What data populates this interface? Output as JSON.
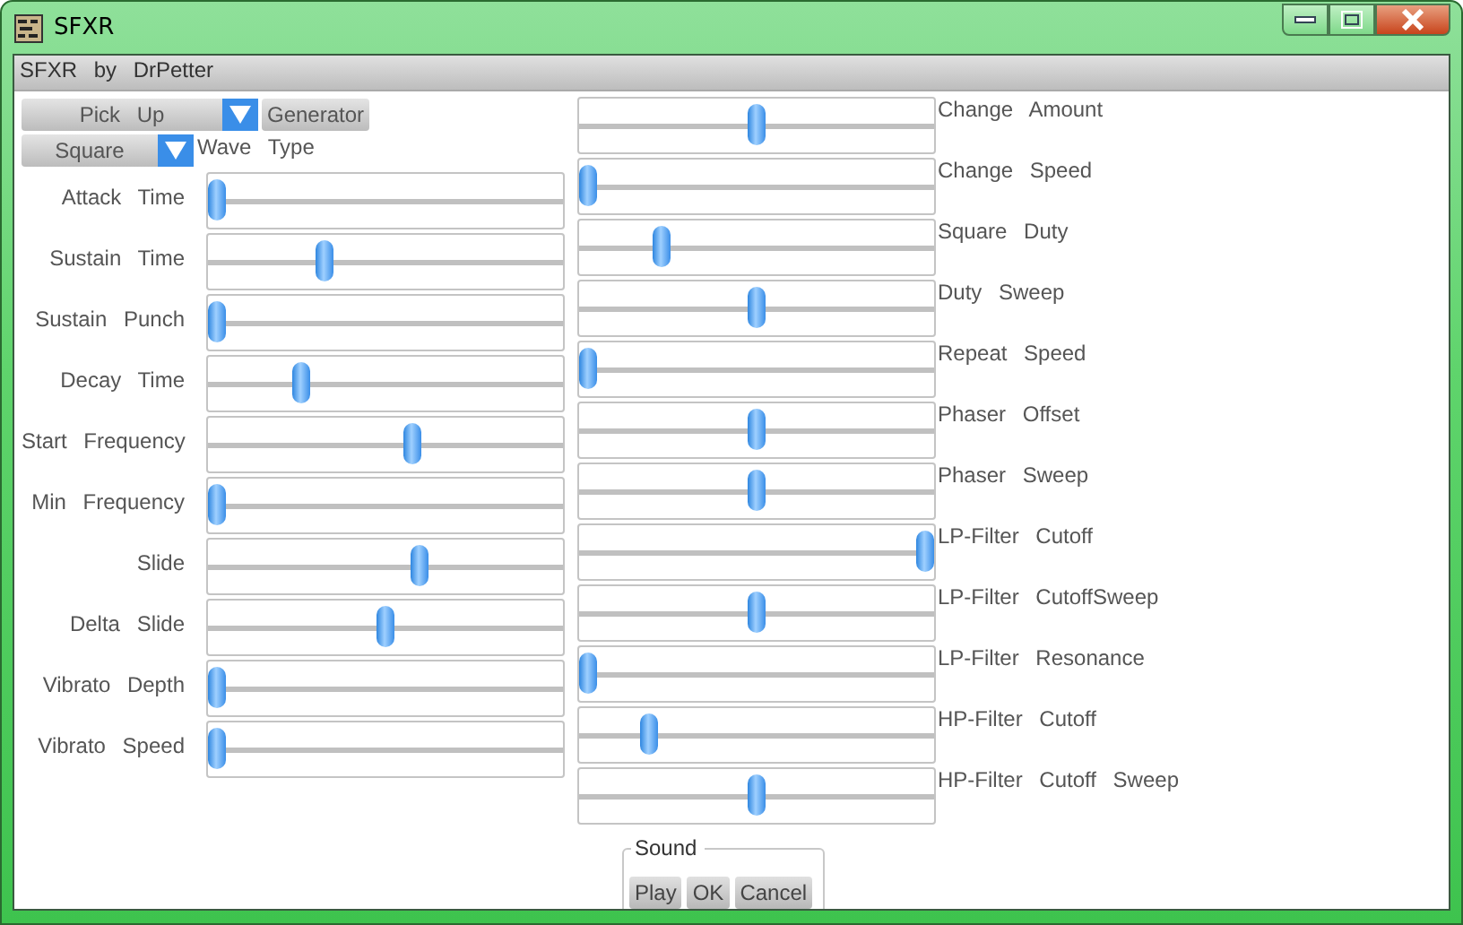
{
  "window": {
    "title": "SFXR"
  },
  "menu_bar": {
    "title": "SFXR by DrPetter"
  },
  "preset_dropdown": {
    "value": "Pick Up"
  },
  "generator_button": "Generator",
  "wave_dropdown": {
    "value": "Square"
  },
  "wave_label": "Wave Type",
  "left_sliders": [
    {
      "label": "Attack Time",
      "level": 0
    },
    {
      "label": "Sustain Time",
      "level": 0.32
    },
    {
      "label": "Sustain Punch",
      "level": 0
    },
    {
      "label": "Decay Time",
      "level": 0.25
    },
    {
      "label": "Start Frequency",
      "level": 0.58
    },
    {
      "label": "Min Frequency",
      "level": 0
    },
    {
      "label": "Slide",
      "level": 0.6
    },
    {
      "label": "Delta Slide",
      "level": 0.5
    },
    {
      "label": "Vibrato Depth",
      "level": 0
    },
    {
      "label": "Vibrato Speed",
      "level": 0
    }
  ],
  "right_sliders": [
    {
      "label": "Change Amount",
      "level": 0.5
    },
    {
      "label": "Change Speed",
      "level": 0
    },
    {
      "label": "Square Duty",
      "level": 0.22
    },
    {
      "label": "Duty Sweep",
      "level": 0.5
    },
    {
      "label": "Repeat Speed",
      "level": 0
    },
    {
      "label": "Phaser Offset",
      "level": 0.5
    },
    {
      "label": "Phaser Sweep",
      "level": 0.5
    },
    {
      "label": "LP-Filter Cutoff",
      "level": 1
    },
    {
      "label": "LP-Filter CutoffSweep",
      "level": 0.5
    },
    {
      "label": "LP-Filter Resonance",
      "level": 0
    },
    {
      "label": "HP-Filter Cutoff",
      "level": 0.18
    },
    {
      "label": "HP-Filter Cutoff Sweep",
      "level": 0.5
    }
  ],
  "sound_group": {
    "title": "Sound",
    "buttons": [
      "Play",
      "OK",
      "Cancel"
    ]
  }
}
